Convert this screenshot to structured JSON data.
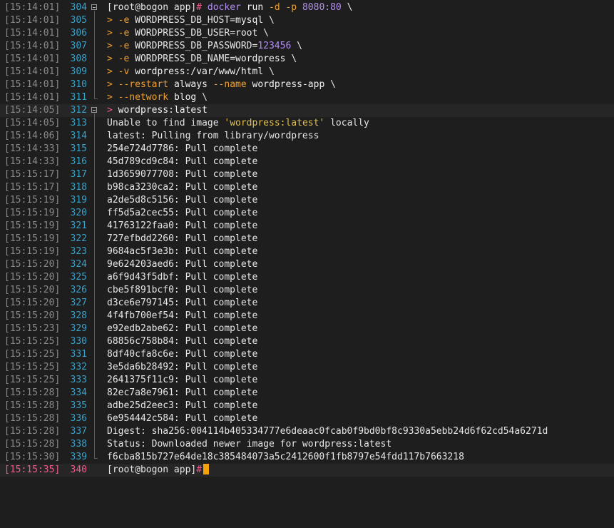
{
  "prompt": "[root@bogon app]#",
  "cmd": {
    "docker": "docker",
    "run": "run",
    "d": "-d",
    "p": "-p",
    "port": "8080:80",
    "e": "-e",
    "host_key": "WORDPRESS_DB_HOST=",
    "host_val": "mysql",
    "user_key": "WORDPRESS_DB_USER=",
    "user_val": "root",
    "pass_key": "WORDPRESS_DB_PASSWORD=",
    "pass_val": "123456",
    "name_key": "WORDPRESS_DB_NAME=",
    "name_val": "wordpress",
    "v": "-v",
    "volume": "wordpress:/var/www/html",
    "restart_flag": "--restart",
    "restart_val": "always",
    "name_flag": "--name",
    "name_val2": "wordpress-app",
    "network_flag": "--network",
    "network_val": "blog",
    "image": "wordpress",
    "tag": "latest",
    "cont": ">",
    "backslash": "\\"
  },
  "lines": [
    {
      "ts": "[15:14:01]",
      "n": "304"
    },
    {
      "ts": "[15:14:01]",
      "n": "305"
    },
    {
      "ts": "[15:14:01]",
      "n": "306"
    },
    {
      "ts": "[15:14:01]",
      "n": "307"
    },
    {
      "ts": "[15:14:01]",
      "n": "308"
    },
    {
      "ts": "[15:14:01]",
      "n": "309"
    },
    {
      "ts": "[15:14:01]",
      "n": "310"
    },
    {
      "ts": "[15:14:01]",
      "n": "311"
    },
    {
      "ts": "[15:14:05]",
      "n": "312"
    },
    {
      "ts": "[15:14:05]",
      "n": "313",
      "text": "Unable to find image 'wordpress:latest' locally"
    },
    {
      "ts": "[15:14:06]",
      "n": "314",
      "text": "latest: Pulling from library/wordpress"
    },
    {
      "ts": "[15:14:33]",
      "n": "315",
      "text": "254e724d7786: Pull complete"
    },
    {
      "ts": "[15:14:33]",
      "n": "316",
      "text": "45d789cd9c84: Pull complete"
    },
    {
      "ts": "[15:15:17]",
      "n": "317",
      "text": "1d3659077708: Pull complete"
    },
    {
      "ts": "[15:15:17]",
      "n": "318",
      "text": "b98ca3230ca2: Pull complete"
    },
    {
      "ts": "[15:15:19]",
      "n": "319",
      "text": "a2de5d8c5156: Pull complete"
    },
    {
      "ts": "[15:15:19]",
      "n": "320",
      "text": "ff5d5a2cec55: Pull complete"
    },
    {
      "ts": "[15:15:19]",
      "n": "321",
      "text": "41763122faa0: Pull complete"
    },
    {
      "ts": "[15:15:19]",
      "n": "322",
      "text": "727efbdd2260: Pull complete"
    },
    {
      "ts": "[15:15:19]",
      "n": "323",
      "text": "9684ac5f3e3b: Pull complete"
    },
    {
      "ts": "[15:15:20]",
      "n": "324",
      "text": "9e624203aed6: Pull complete"
    },
    {
      "ts": "[15:15:20]",
      "n": "325",
      "text": "a6f9d43f5dbf: Pull complete"
    },
    {
      "ts": "[15:15:20]",
      "n": "326",
      "text": "cbe5f891bcf0: Pull complete"
    },
    {
      "ts": "[15:15:20]",
      "n": "327",
      "text": "d3ce6e797145: Pull complete"
    },
    {
      "ts": "[15:15:20]",
      "n": "328",
      "text": "4f4fb700ef54: Pull complete"
    },
    {
      "ts": "[15:15:23]",
      "n": "329",
      "text": "e92edb2abe62: Pull complete"
    },
    {
      "ts": "[15:15:25]",
      "n": "330",
      "text": "68856c758b84: Pull complete"
    },
    {
      "ts": "[15:15:25]",
      "n": "331",
      "text": "8df40cfa8c6e: Pull complete"
    },
    {
      "ts": "[15:15:25]",
      "n": "332",
      "text": "3e5da6b28492: Pull complete"
    },
    {
      "ts": "[15:15:25]",
      "n": "333",
      "text": "2641375f11c9: Pull complete"
    },
    {
      "ts": "[15:15:28]",
      "n": "334",
      "text": "82ec7a8e7961: Pull complete"
    },
    {
      "ts": "[15:15:28]",
      "n": "335",
      "text": "adbe25d2eec3: Pull complete"
    },
    {
      "ts": "[15:15:28]",
      "n": "336",
      "text": "6e954442c584: Pull complete"
    },
    {
      "ts": "[15:15:28]",
      "n": "337",
      "text": "Digest: sha256:004114b405334777e6deaac0fcab0f9bd0bf8c9330a5ebb24d6f62cd54a6271d"
    },
    {
      "ts": "[15:15:28]",
      "n": "338",
      "text": "Status: Downloaded newer image for wordpress:latest"
    },
    {
      "ts": "[15:15:30]",
      "n": "339",
      "text": "f6cba815b727e64de18c385484073a5c2412600f1fb8797e54fdd117b7663218"
    },
    {
      "ts": "[15:15:35]",
      "n": "340"
    }
  ],
  "colors": {
    "prompt_hash": "#f05a8f",
    "flag": "#f0a030",
    "number": "#b38ff0",
    "string": "#e0c050",
    "cursor": "#f5a20a"
  },
  "icons": {
    "fold": "fold-collapse-icon"
  }
}
